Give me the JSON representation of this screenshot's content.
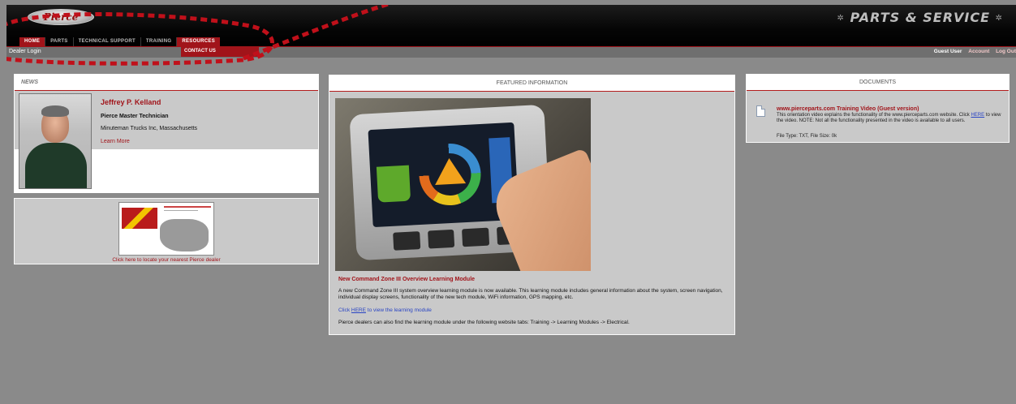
{
  "header": {
    "logo_text": "Pierce",
    "brand": "PARTS & SERVICE"
  },
  "nav": {
    "items": [
      {
        "label": "HOME"
      },
      {
        "label": "PARTS"
      },
      {
        "label": "TECHNICAL SUPPORT"
      },
      {
        "label": "TRAINING"
      },
      {
        "label": "RESOURCES"
      }
    ],
    "dropdown_item": "CONTACT US"
  },
  "subbar": {
    "breadcrumb": "Dealer Login",
    "user": "Guest User",
    "account": "Account",
    "logout": "Log Out"
  },
  "news": {
    "title": "NEWS",
    "name": "Jeffrey P. Kelland",
    "role": "Pierce Master Technician",
    "org": "Minuteman Trucks Inc, Massachusetts",
    "more": "Learn More"
  },
  "dealer": {
    "link": "Click here to locate your nearest Pierce dealer"
  },
  "featured": {
    "title": "FEATURED INFORMATION",
    "headline": "New Command Zone III Overview Learning Module",
    "body": "A new Command Zone III system overview learning module is now available. This learning module includes general information about the system, screen navigation, individual display screens, functionality of the new tech module, WiFi information, GPS mapping, etc.",
    "click_prefix": "Click",
    "click_link": "HERE",
    "click_suffix": "to view the learning module",
    "dealers_note": "Pierce dealers can also find the learning module under the following website tabs: Training -> Learning Modules -> Electrical."
  },
  "documents": {
    "title": "DOCUMENTS",
    "item_title": "www.pierceparts.com Training Video (Guest version)",
    "item_desc_1": "This orientation video explains the functionality of the www.pierceparts.com website. Click",
    "item_link": "HERE",
    "item_desc_2": "to view the video. NOTE: Not all the functionality presented in the video is available to all users.",
    "item_meta": "File Type: TXT, File Size: 0k"
  },
  "colors": {
    "accent": "#a1141a",
    "annotation": "#c0101a",
    "background": "#8a8a8a"
  }
}
